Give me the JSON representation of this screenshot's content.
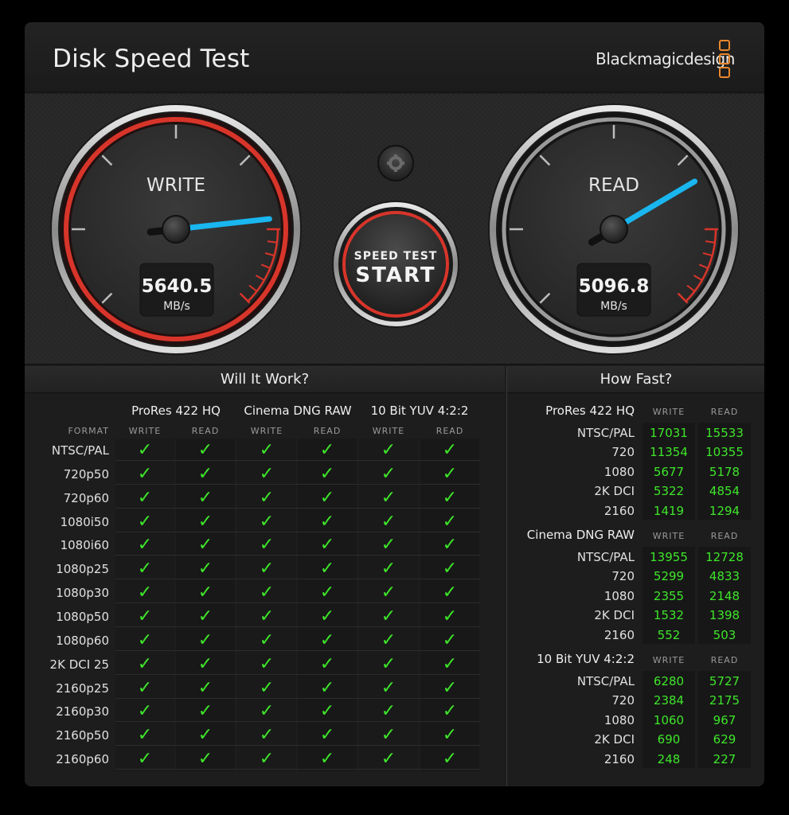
{
  "window": {
    "close": "✕",
    "title": "Disk Speed Test",
    "brand": "Blackmagicdesign"
  },
  "colors": {
    "accent_red": "#d8352a",
    "needle": "#19b6f0",
    "check_green": "#3ee62a",
    "brand_orange": "#e9872a"
  },
  "gauges": {
    "write": {
      "label": "WRITE",
      "value": "5640.5",
      "unit": "MB/s",
      "needle_fraction": 0.81
    },
    "read": {
      "label": "READ",
      "value": "5096.8",
      "unit": "MB/s",
      "needle_fraction": 0.72
    }
  },
  "settings_icon": "gear-icon",
  "start": {
    "line1": "SPEED TEST",
    "line2": "START"
  },
  "will_it_work": {
    "title": "Will It Work?",
    "format_header": "FORMAT",
    "write_label": "WRITE",
    "read_label": "READ",
    "codecs": [
      "ProRes 422 HQ",
      "Cinema DNG RAW",
      "10 Bit YUV 4:2:2"
    ],
    "check": "✓",
    "formats": [
      "NTSC/PAL",
      "720p50",
      "720p60",
      "1080i50",
      "1080i60",
      "1080p25",
      "1080p30",
      "1080p50",
      "1080p60",
      "2K DCI 25",
      "2160p25",
      "2160p30",
      "2160p50",
      "2160p60"
    ]
  },
  "how_fast": {
    "title": "How Fast?",
    "write_label": "WRITE",
    "read_label": "READ",
    "groups": [
      {
        "name": "ProRes 422 HQ",
        "rows": [
          {
            "res": "NTSC/PAL",
            "write": "17031",
            "read": "15533"
          },
          {
            "res": "720",
            "write": "11354",
            "read": "10355"
          },
          {
            "res": "1080",
            "write": "5677",
            "read": "5178"
          },
          {
            "res": "2K DCI",
            "write": "5322",
            "read": "4854"
          },
          {
            "res": "2160",
            "write": "1419",
            "read": "1294"
          }
        ]
      },
      {
        "name": "Cinema DNG RAW",
        "rows": [
          {
            "res": "NTSC/PAL",
            "write": "13955",
            "read": "12728"
          },
          {
            "res": "720",
            "write": "5299",
            "read": "4833"
          },
          {
            "res": "1080",
            "write": "2355",
            "read": "2148"
          },
          {
            "res": "2K DCI",
            "write": "1532",
            "read": "1398"
          },
          {
            "res": "2160",
            "write": "552",
            "read": "503"
          }
        ]
      },
      {
        "name": "10 Bit YUV 4:2:2",
        "rows": [
          {
            "res": "NTSC/PAL",
            "write": "6280",
            "read": "5727"
          },
          {
            "res": "720",
            "write": "2384",
            "read": "2175"
          },
          {
            "res": "1080",
            "write": "1060",
            "read": "967"
          },
          {
            "res": "2K DCI",
            "write": "690",
            "read": "629"
          },
          {
            "res": "2160",
            "write": "248",
            "read": "227"
          }
        ]
      }
    ]
  }
}
